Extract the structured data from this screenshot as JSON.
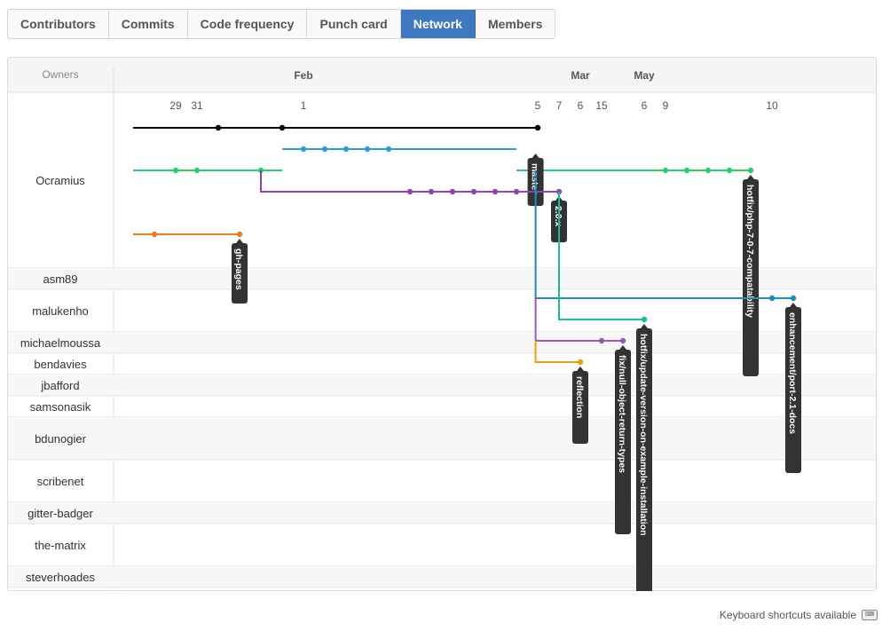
{
  "tabs": [
    {
      "label": "Contributors",
      "active": false
    },
    {
      "label": "Commits",
      "active": false
    },
    {
      "label": "Code frequency",
      "active": false
    },
    {
      "label": "Punch card",
      "active": false
    },
    {
      "label": "Network",
      "active": true
    },
    {
      "label": "Members",
      "active": false
    }
  ],
  "network": {
    "owners_header": "Owners",
    "months": [
      {
        "label": "Feb",
        "col": 8
      },
      {
        "label": "Mar",
        "col": 21
      },
      {
        "label": "May",
        "col": 24
      }
    ],
    "days": [
      {
        "label": "29",
        "col": 2
      },
      {
        "label": "31",
        "col": 3
      },
      {
        "label": "1",
        "col": 8
      },
      {
        "label": "5",
        "col": 19
      },
      {
        "label": "7",
        "col": 20
      },
      {
        "label": "6",
        "col": 21
      },
      {
        "label": "15",
        "col": 22
      },
      {
        "label": "6",
        "col": 24
      },
      {
        "label": "9",
        "col": 25
      },
      {
        "label": "10",
        "col": 30
      }
    ],
    "owners": [
      {
        "name": "Ocramius",
        "rows": 7
      },
      {
        "name": "asm89",
        "rows": 1
      },
      {
        "name": "malukenho",
        "rows": 2
      },
      {
        "name": "michaelmoussa",
        "rows": 1
      },
      {
        "name": "bendavies",
        "rows": 1
      },
      {
        "name": "jbafford",
        "rows": 1
      },
      {
        "name": "samsonasik",
        "rows": 1
      },
      {
        "name": "bdunogier",
        "rows": 2
      },
      {
        "name": "scribenet",
        "rows": 2
      },
      {
        "name": "gitter-badger",
        "rows": 1
      },
      {
        "name": "the-matrix",
        "rows": 2
      },
      {
        "name": "steverhoades",
        "rows": 1
      }
    ],
    "branches": [
      {
        "id": "black",
        "color": "#000000",
        "points": [
          [
            0,
            1
          ],
          [
            19,
            1
          ]
        ],
        "commits": [
          4,
          7,
          19
        ],
        "label": null
      },
      {
        "id": "green-early",
        "color": "#2ecc71",
        "points": [
          [
            0,
            3
          ],
          [
            7,
            3
          ]
        ],
        "commits": [
          2,
          3,
          6
        ],
        "label": null
      },
      {
        "id": "green-main",
        "color": "#2ecc71",
        "points": [
          [
            18,
            3
          ],
          [
            29,
            3
          ]
        ],
        "commits": [
          25,
          26,
          27,
          28,
          29
        ],
        "label": "hotfix/php-7-0-7-compatability",
        "labelCol": 29
      },
      {
        "id": "blue-1",
        "color": "#3498db",
        "points": [
          [
            7,
            2
          ],
          [
            18,
            2
          ]
        ],
        "commits": [
          8,
          9,
          10,
          11,
          12
        ],
        "label": "master",
        "labelCol": 18.9
      },
      {
        "id": "purple-main",
        "color": "#8e44ad",
        "points": [
          [
            6,
            3
          ],
          [
            6,
            4
          ],
          [
            20,
            4
          ]
        ],
        "commits": [
          13,
          14,
          15,
          16,
          17,
          18,
          20
        ],
        "label": "2.0.x",
        "labelCol": 20
      },
      {
        "id": "orange-pages",
        "color": "#e67e22",
        "points": [
          [
            0,
            6
          ],
          [
            5,
            6
          ]
        ],
        "commits": [
          1,
          5
        ],
        "label": "gh-pages",
        "labelCol": 5
      },
      {
        "id": "teal-master",
        "color": "#1f8bb6",
        "points": [
          [
            18.9,
            3
          ],
          [
            18.9,
            9
          ],
          [
            31,
            9
          ]
        ],
        "commits": [
          30,
          31
        ],
        "label": "enhancement/port-2.1-docs",
        "labelCol": 31
      },
      {
        "id": "teal-update",
        "color": "#1abc9c",
        "points": [
          [
            20,
            4
          ],
          [
            20,
            10
          ],
          [
            24,
            10
          ]
        ],
        "commits": [
          24
        ],
        "label": "hotfix/update-version-on-example-installation",
        "labelCol": 24
      },
      {
        "id": "purple-fix",
        "color": "#9b59b6",
        "points": [
          [
            18.9,
            9
          ],
          [
            18.9,
            11
          ],
          [
            23,
            11
          ]
        ],
        "commits": [
          22,
          23
        ],
        "label": "fix/null-object-return-types",
        "labelCol": 23
      },
      {
        "id": "orange-refl",
        "color": "#f39c12",
        "points": [
          [
            18.9,
            11
          ],
          [
            18.9,
            12
          ],
          [
            21,
            12
          ]
        ],
        "commits": [
          21
        ],
        "label": "reflection",
        "labelCol": 21
      }
    ]
  },
  "footer": {
    "shortcuts": "Keyboard shortcuts available",
    "icon": "keyboard-icon"
  }
}
